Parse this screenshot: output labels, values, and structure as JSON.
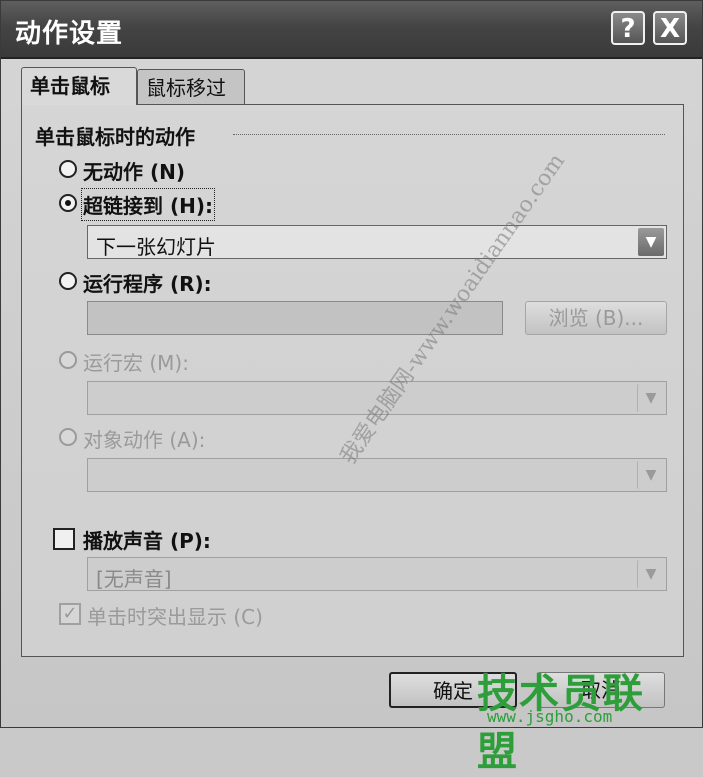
{
  "window": {
    "title": "动作设置",
    "help_label": "?",
    "close_label": "X"
  },
  "tabs": [
    {
      "label": "单击鼠标",
      "active": true
    },
    {
      "label": "鼠标移过",
      "active": false
    }
  ],
  "group": {
    "title": "单击鼠标时的动作"
  },
  "options": {
    "none": {
      "label": "无动作 (N)",
      "checked": false,
      "enabled": true
    },
    "hyperlink": {
      "label": "超链接到 (H):",
      "checked": true,
      "enabled": true
    },
    "run_program": {
      "label": "运行程序 (R):",
      "checked": false,
      "enabled": true
    },
    "run_macro": {
      "label": "运行宏 (M):",
      "checked": false,
      "enabled": false
    },
    "object_action": {
      "label": "对象动作 (A):",
      "checked": false,
      "enabled": false
    }
  },
  "hyperlink_select": {
    "value": "下一张幻灯片"
  },
  "run_program_input": {
    "value": ""
  },
  "browse_button": {
    "label": "浏览 (B)..."
  },
  "macro_select": {
    "value": ""
  },
  "object_action_select": {
    "value": ""
  },
  "play_sound": {
    "label": "播放声音 (P):",
    "checked": false
  },
  "sound_select": {
    "value": "[无声音]"
  },
  "highlight_click": {
    "label": "单击时突出显示 (C)",
    "checked": true,
    "enabled": false
  },
  "footer": {
    "ok_label": "确定",
    "cancel_label": "取消"
  },
  "overlay": {
    "watermark": "我爱电脑网-www.woaidiannao.com",
    "logo_text": "技术员联盟",
    "logo_url": "www.jsgho.com"
  },
  "colors": {
    "titlebar": "#444444",
    "dialog_bg": "#cfcfcf",
    "logo_green": "#2e9e3a"
  }
}
